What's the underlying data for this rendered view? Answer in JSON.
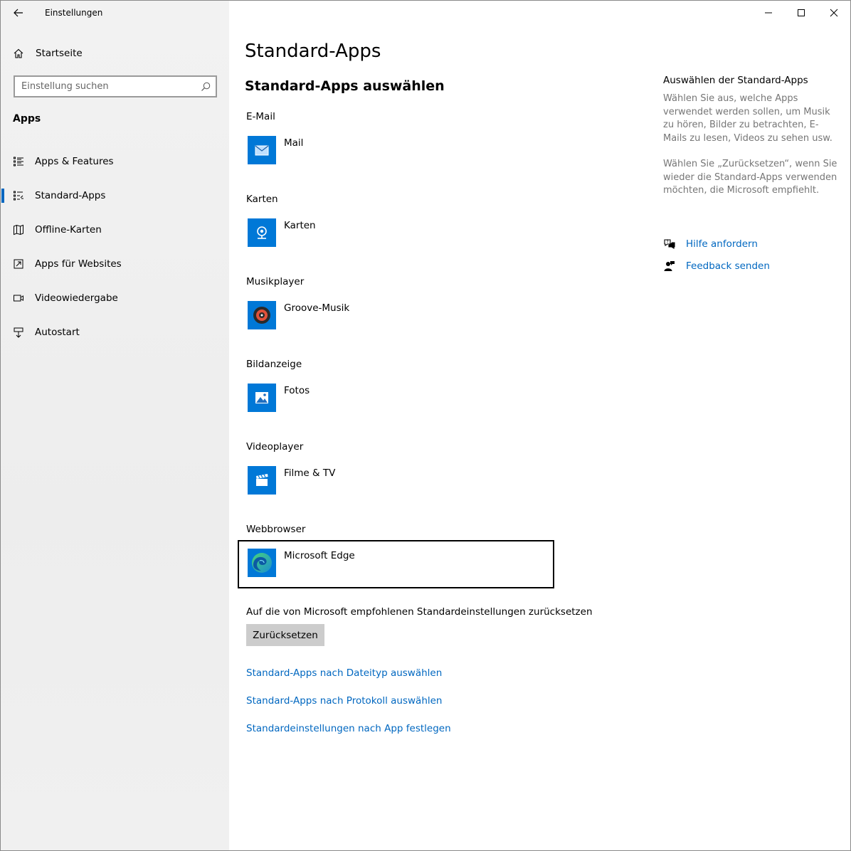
{
  "window": {
    "title": "Einstellungen",
    "controls": [
      "minimize-icon",
      "maximize-icon",
      "close-icon"
    ]
  },
  "sidebar": {
    "home_label": "Startseite",
    "search_placeholder": "Einstellung suchen",
    "section_title": "Apps",
    "items": [
      {
        "label": "Apps & Features",
        "icon": "list-icon",
        "active": false
      },
      {
        "label": "Standard-Apps",
        "icon": "default-apps-icon",
        "active": true
      },
      {
        "label": "Offline-Karten",
        "icon": "map-icon",
        "active": false
      },
      {
        "label": "Apps für Websites",
        "icon": "open-link-icon",
        "active": false
      },
      {
        "label": "Videowiedergabe",
        "icon": "video-icon",
        "active": false
      },
      {
        "label": "Autostart",
        "icon": "startup-icon",
        "active": false
      }
    ]
  },
  "main": {
    "title": "Standard-Apps",
    "subtitle": "Standard-Apps auswählen",
    "categories": [
      {
        "category": "E-Mail",
        "app": "Mail",
        "icon": "mail-icon"
      },
      {
        "category": "Karten",
        "app": "Karten",
        "icon": "maps-app-icon"
      },
      {
        "category": "Musikplayer",
        "app": "Groove-Musik",
        "icon": "groove-music-icon"
      },
      {
        "category": "Bildanzeige",
        "app": "Fotos",
        "icon": "photos-icon"
      },
      {
        "category": "Videoplayer",
        "app": "Filme & TV",
        "icon": "movies-tv-icon"
      },
      {
        "category": "Webbrowser",
        "app": "Microsoft Edge",
        "icon": "edge-icon"
      }
    ],
    "reset_text": "Auf die von Microsoft empfohlenen Standardeinstellungen zurücksetzen",
    "reset_button": "Zurücksetzen",
    "links": [
      "Standard-Apps nach Dateityp auswählen",
      "Standard-Apps nach Protokoll auswählen",
      "Standardeinstellungen nach App festlegen"
    ]
  },
  "aside": {
    "title": "Auswählen der Standard-Apps",
    "paragraph1": "Wählen Sie aus, welche Apps verwendet werden sollen, um Musik zu hören, Bilder zu betrachten, E-Mails zu lesen, Videos zu sehen usw.",
    "paragraph2": "Wählen Sie „Zurücksetzen“, wenn Sie wieder die Standard-Apps verwenden möchten, die Microsoft empfiehlt.",
    "help_link": "Hilfe anfordern",
    "feedback_link": "Feedback senden"
  },
  "colors": {
    "accent": "#0067c0",
    "tile": "#0078d7",
    "sidebar_bg": "#f0f0f0",
    "muted_text": "#767676"
  }
}
